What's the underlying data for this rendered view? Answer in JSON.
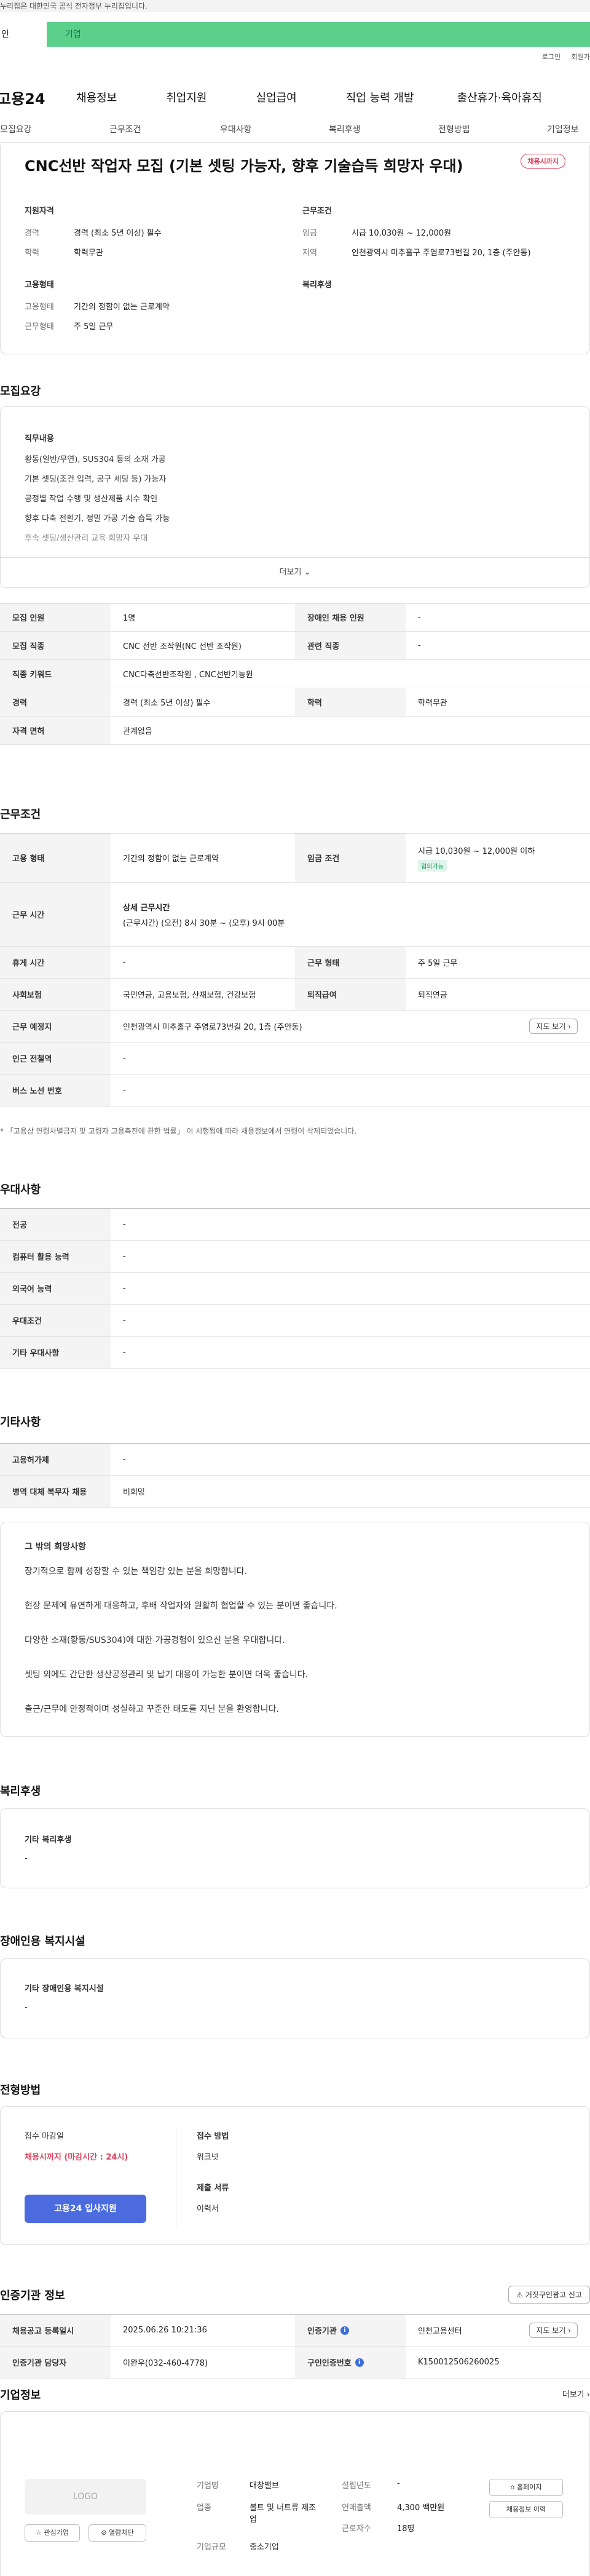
{
  "gov_notice": "누리집은 대한민국 공식 전자정부 누리집입니다.",
  "segment": {
    "left": "인",
    "right": "기업"
  },
  "util_links": [
    "로그인",
    "회원가"
  ],
  "gnb": {
    "logo": "고용24",
    "menus": [
      "채용정보",
      "취업지원",
      "실업급여",
      "직업 능력 개발",
      "출산휴가·육아휴직"
    ]
  },
  "sub_tabs": [
    "모집요강",
    "근무조건",
    "우대사항",
    "복리후생",
    "전형방법",
    "기업정보"
  ],
  "job": {
    "title": "CNC선반 작업자 모집 (기본 셋팅 가능자, 향후 기술습득 희망자 우대)",
    "status_badge": "채용시까지",
    "qualification_label": "지원자격",
    "career_k": "경력",
    "career_v": "경력 (최소 5년 이상) 필수",
    "edu_k": "학력",
    "edu_v": "학력무관",
    "work_label": "근무조건",
    "wage_k": "임금",
    "wage_v": "시급 10,030원 ~ 12,000원",
    "region_k": "지역",
    "region_v": "인천광역시 미추홀구 주염로73번길 20, 1층 (주안동)",
    "employment_label": "고용형태",
    "emp_type_k": "고용형태",
    "emp_type_v": "기간의 정함이 없는 근로계약",
    "work_form_k": "근무형태",
    "work_form_v": "주 5일 근무",
    "welfare_label": "복리후생"
  },
  "recruit": {
    "section_title": "모집요강",
    "duty_label": "직무내용",
    "duties": [
      "황동(일반/무연), SUS304 등의 소재 가공",
      "기본 셋팅(조건 입력, 공구 세팅 등) 가능자",
      "공정별 작업 수행 및 생산제품 치수 확인",
      "향후 다축 전환기, 정밀 가공 기술 습득 가능",
      "후속 셋팅/생산관리 교육 희망자 우대"
    ],
    "more_label": "더보기",
    "rows": [
      {
        "k1": "모집 인원",
        "v1": "1명",
        "k2": "장애인 채용 인원",
        "v2": "-"
      },
      {
        "k1": "모집 직종",
        "v1": "CNC 선반 조작원(NC 선반 조작원)",
        "k2": "관련 직종",
        "v2": "-"
      },
      {
        "k1": "직종 키워드",
        "v1": "CNC다축선반조작원 , CNC선반기능원"
      },
      {
        "k1": "경력",
        "v1": "경력 (최소 5년 이상) 필수",
        "k2": "학력",
        "v2": "학력무관"
      },
      {
        "k1": "자격 면허",
        "v1": "관계없음"
      }
    ]
  },
  "work_cond": {
    "section_title": "근무조건",
    "emp_type_k": "고용 형태",
    "emp_type_v": "기간의 정함이 없는 근로계약",
    "wage_k": "임금 조건",
    "wage_v": "시급 10,030원 ~ 12,000원 이하",
    "wage_tag": "협의가능",
    "time_k": "근무 시간",
    "time_title": "상세 근무시간",
    "time_v": "(근무시간) (오전) 8시 30분 ~ (오후) 9시 00분",
    "rest_k": "휴게 시간",
    "rest_v": "-",
    "form_k": "근무 형태",
    "form_v": "주 5일 근무",
    "ins_k": "사회보험",
    "ins_v": "국민연금, 고용보험, 산재보험, 건강보험",
    "sev_k": "퇴직급여",
    "sev_v": "퇴직연금",
    "place_k": "근무 예정지",
    "place_v": "인천광역시 미추홀구 주염로73번길 20, 1층 (주안동)",
    "map_btn": "지도 보기",
    "station_k": "인근 전철역",
    "station_v": "-",
    "bus_k": "버스 노선 번호",
    "bus_v": "-",
    "note": "* 「고용상 연령차별금지 및 고령자 고용촉진에 관한 법률」 이 시행됨에 따라 채용정보에서 연령이 삭제되었습니다."
  },
  "prefer": {
    "section_title": "우대사항",
    "rows": [
      {
        "k": "전공",
        "v": "-"
      },
      {
        "k": "컴퓨터 활용 능력",
        "v": "-"
      },
      {
        "k": "외국어 능력",
        "v": "-"
      },
      {
        "k": "우대조건",
        "v": "-"
      },
      {
        "k": "기타 우대사항",
        "v": "-"
      }
    ]
  },
  "etc": {
    "section_title": "기타사항",
    "rows": [
      {
        "k": "고용허가제",
        "v": "-"
      },
      {
        "k": "병역 대체 복무자 채용",
        "v": "비희망"
      }
    ],
    "wish_title": "그 밖의 희망사항",
    "wishes": [
      "장기적으로 함께 성장할 수 있는 책임감 있는 분을 희망합니다.",
      "현장 문제에 유연하게 대응하고, 후배 작업자와 원활히 협업할 수 있는 분이면 좋습니다.",
      "다양한 소재(황동/SUS304)에 대한 가공경험이 있으신 분을 우대합니다.",
      "셋팅 외에도 간단한 생산공정관리 및 납기 대응이 가능한 분이면 더욱 좋습니다.",
      "출근/근무에 안정적이며 성실하고 꾸준한 태도를 지닌 분을 환영합니다."
    ]
  },
  "welfare": {
    "section_title": "복리후생",
    "box_title": "기타 복리후생",
    "box_value": "-"
  },
  "disabled": {
    "section_title": "장애인용 복지시설",
    "box_title": "기타 장애인용 복지시설",
    "box_value": "-"
  },
  "screening": {
    "section_title": "전형방법",
    "deadline_k": "접수 마감일",
    "deadline_v": "채용시까지 (마감시간 : 24시)",
    "apply_btn": "고용24 입사지원",
    "method_k": "접수 방법",
    "method_v": "워크넷",
    "docs_k": "제출 서류",
    "docs_v": "이력서"
  },
  "cert": {
    "section_title": "인증기관 정보",
    "report_btn": "거짓구인광고 신고",
    "reg_k": "채용공고 등록일시",
    "reg_v": "2025.06.26 10:21:36",
    "org_k": "인증기관",
    "org_v": "인천고용센터",
    "map_btn": "지도 보기",
    "mgr_k": "인증기관 담당자",
    "mgr_v": "이완우(032-460-4778)",
    "no_k": "구인인증번호",
    "no_v": "K150012506260025"
  },
  "company": {
    "section_title": "기업정보",
    "more": "더보기",
    "logo": "LOGO",
    "fav_btn": "관심기업",
    "block_btn": "열람차단",
    "name_k": "기업명",
    "name_v": "대창밸브",
    "industry_k": "업종",
    "industry_v": "볼트 및 너트류 제조업",
    "size_k": "기업규모",
    "size_v": "중소기업",
    "year_k": "설립년도",
    "year_v": "-",
    "sales_k": "연매출액",
    "sales_v": "4,300 백만원",
    "emp_k": "근로자수",
    "emp_v": "18명",
    "home_btn": "홈페이지",
    "history_btn": "채용정보 이력"
  }
}
